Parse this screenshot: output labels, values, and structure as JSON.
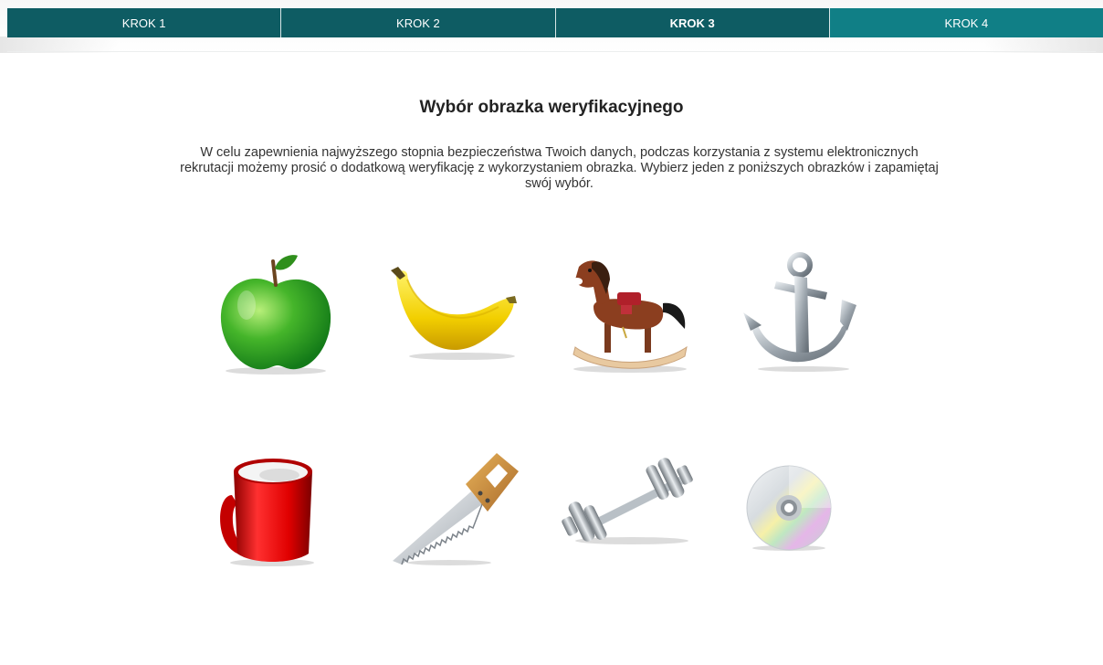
{
  "steps": [
    {
      "label": "KROK 1"
    },
    {
      "label": "KROK 2"
    },
    {
      "label": "KROK 3"
    },
    {
      "label": "KROK 4"
    }
  ],
  "active_step_index": 2,
  "colors": {
    "step_bg": "#0e5c63",
    "step_next_bg": "#107f86"
  },
  "heading": "Wybór obrazka weryfikacyjnego",
  "description": "W celu zapewnienia najwyższego stopnia bezpieczeństwa Twoich danych, podczas korzystania z systemu elektronicznych rekrutacji możemy prosić o dodatkową weryfikację z wykorzystaniem obrazka. Wybierz jeden z poniższych obrazków i zapamiętaj swój wybór.",
  "images": [
    {
      "icon": "apple-icon"
    },
    {
      "icon": "banana-icon"
    },
    {
      "icon": "rocking-horse-icon"
    },
    {
      "icon": "anchor-icon"
    },
    {
      "icon": "mug-icon"
    },
    {
      "icon": "saw-icon"
    },
    {
      "icon": "dumbbell-icon"
    },
    {
      "icon": "cd-disc-icon"
    }
  ]
}
